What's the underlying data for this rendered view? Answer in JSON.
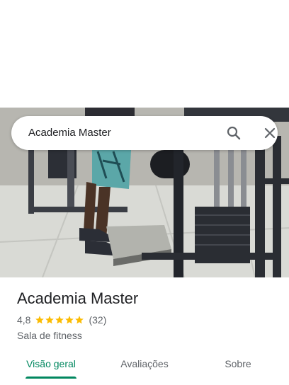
{
  "search": {
    "query": "Academia Master"
  },
  "place": {
    "name": "Academia Master",
    "rating": "4,8",
    "stars": 5,
    "review_count": "(32)",
    "category": "Sala de fitness"
  },
  "tabs": [
    {
      "label": "Visão geral",
      "active": true
    },
    {
      "label": "Avaliações",
      "active": false
    },
    {
      "label": "Sobre",
      "active": false
    }
  ],
  "colors": {
    "accent": "#01875f",
    "star": "#fbbc04",
    "text_primary": "#202124",
    "text_secondary": "#5f6368"
  },
  "icons": {
    "search": "search-icon",
    "close": "close-icon",
    "star": "star-icon"
  }
}
